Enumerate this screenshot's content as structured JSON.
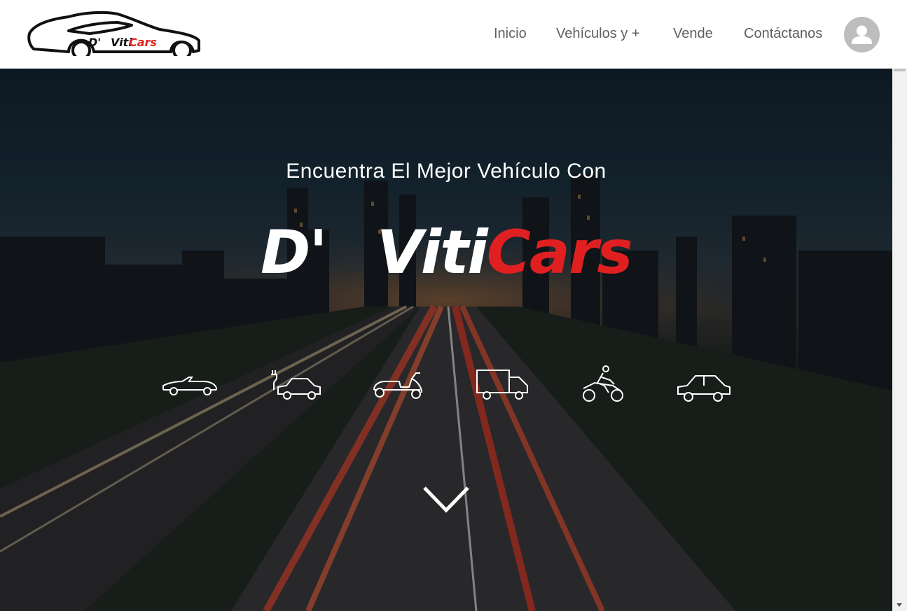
{
  "brand": {
    "logo_text_prefix": "D'",
    "logo_text_white": "Viti",
    "logo_text_red": "Cars"
  },
  "nav": {
    "items": [
      {
        "label": "Inicio"
      },
      {
        "label": "Vehículos y +"
      },
      {
        "label": "Vende"
      },
      {
        "label": "Contáctanos"
      }
    ]
  },
  "hero": {
    "subtitle": "Encuentra El Mejor Vehículo Con",
    "title_prefix": "D'",
    "title_white": "Viti",
    "title_red": "Cars"
  },
  "vehicle_icons": [
    {
      "icon": "convertible-car-icon"
    },
    {
      "icon": "electric-car-icon"
    },
    {
      "icon": "scooter-icon"
    },
    {
      "icon": "truck-icon"
    },
    {
      "icon": "motorcycle-icon"
    },
    {
      "icon": "hatchback-car-icon"
    }
  ],
  "colors": {
    "accent_red": "#e02020",
    "nav_text": "#5f5f5f",
    "avatar_bg": "#bdbdbd"
  }
}
